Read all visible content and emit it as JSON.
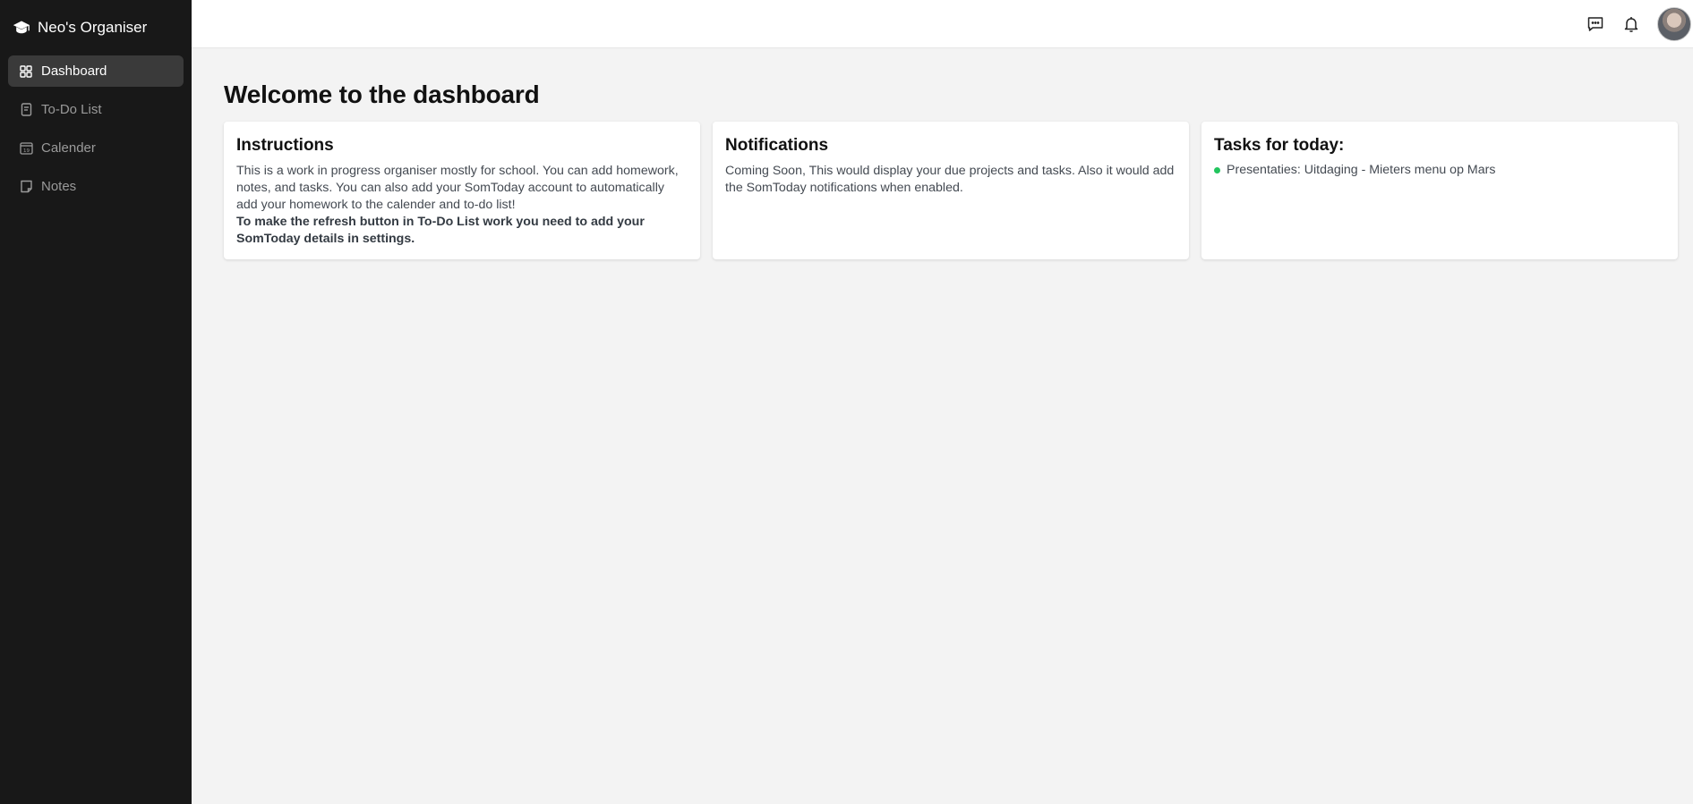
{
  "app": {
    "title": "Neo's Organiser"
  },
  "sidebar": {
    "items": [
      {
        "label": "Dashboard",
        "icon": "dashboard-grid-icon",
        "active": true
      },
      {
        "label": "To-Do List",
        "icon": "todo-list-icon",
        "active": false
      },
      {
        "label": "Calender",
        "icon": "calendar-icon",
        "active": false
      },
      {
        "label": "Notes",
        "icon": "notes-icon",
        "active": false
      }
    ]
  },
  "topbar": {
    "icons": [
      "chat-icon",
      "bell-icon"
    ],
    "avatar": "user-avatar"
  },
  "main": {
    "title": "Welcome to the dashboard",
    "cards": {
      "instructions": {
        "title": "Instructions",
        "text": "This is a work in progress organiser mostly for school. You can add homework, notes, and tasks. You can also add your SomToday account to automatically add your homework to the calender and to-do list!",
        "bold": "To make the refresh button in To-Do List work you need to add your SomToday details in settings."
      },
      "notifications": {
        "title": "Notifications",
        "text": "Coming Soon, This would display your due projects and tasks. Also it would add the SomToday notifications when enabled."
      },
      "tasks": {
        "title": "Tasks for today:",
        "items": [
          "Presentaties: Uitdaging - Mieters menu op Mars"
        ]
      }
    }
  },
  "colors": {
    "sidebar_bg": "#181818",
    "active_item_bg": "#3a3a3a",
    "page_bg": "#f3f3f3",
    "task_dot": "#22c55e"
  }
}
